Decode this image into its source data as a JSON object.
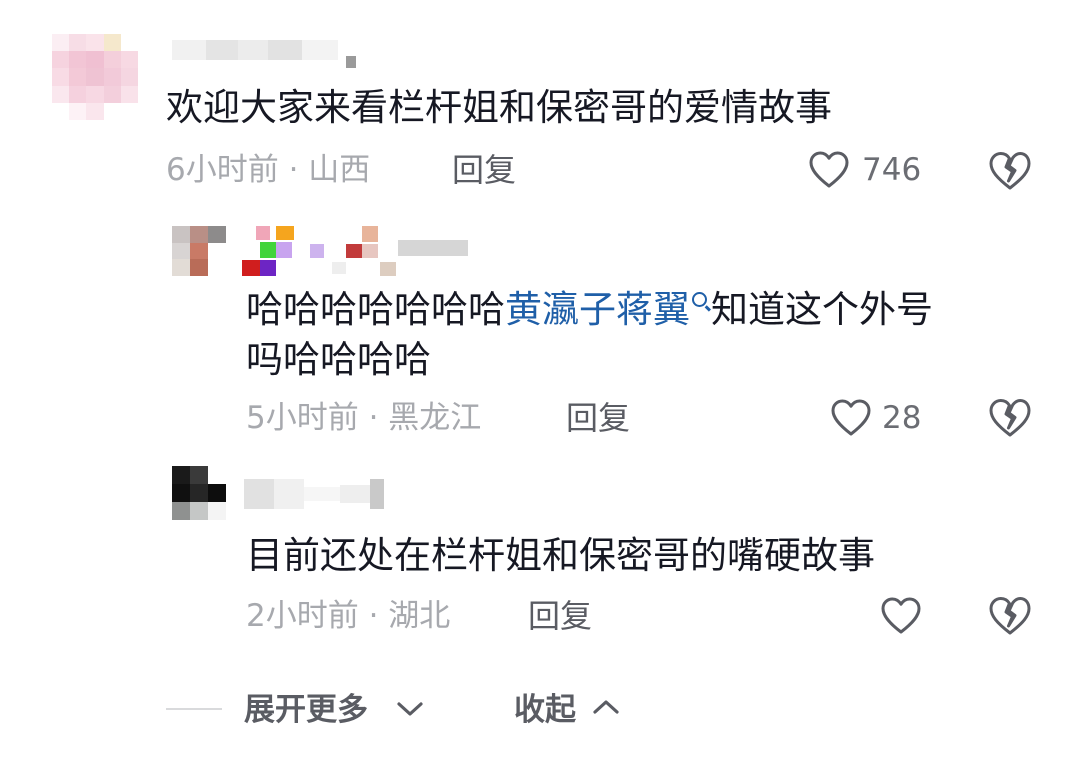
{
  "comments": [
    {
      "text": "欢迎大家来看栏杆姐和保密哥的爱情故事",
      "meta": "6小时前 · 山西",
      "reply_label": "回复",
      "likes": "746",
      "replies": [
        {
          "text_before": "哈哈哈哈哈哈哈",
          "mention": "黄瀛子蒋翼",
          "text_after_line1": "知道这个外号",
          "text_line2": "吗哈哈哈哈",
          "meta": "5小时前 · 黑龙江",
          "reply_label": "回复",
          "likes": "28"
        },
        {
          "text": "目前还处在栏杆姐和保密哥的嘴硬故事",
          "meta": "2小时前 · 湖北",
          "reply_label": "回复",
          "likes": ""
        }
      ]
    }
  ],
  "footer": {
    "expand_label": "展开更多",
    "collapse_label": "收起"
  },
  "icons": {
    "like": "heart-outline-icon",
    "dislike": "broken-heart-icon",
    "expand": "chevron-down-icon",
    "collapse": "chevron-up-icon"
  },
  "colors": {
    "text": "#161823",
    "mention": "#1f5fa8",
    "meta": "#a7a9ae",
    "secondary": "#5a5c63"
  }
}
